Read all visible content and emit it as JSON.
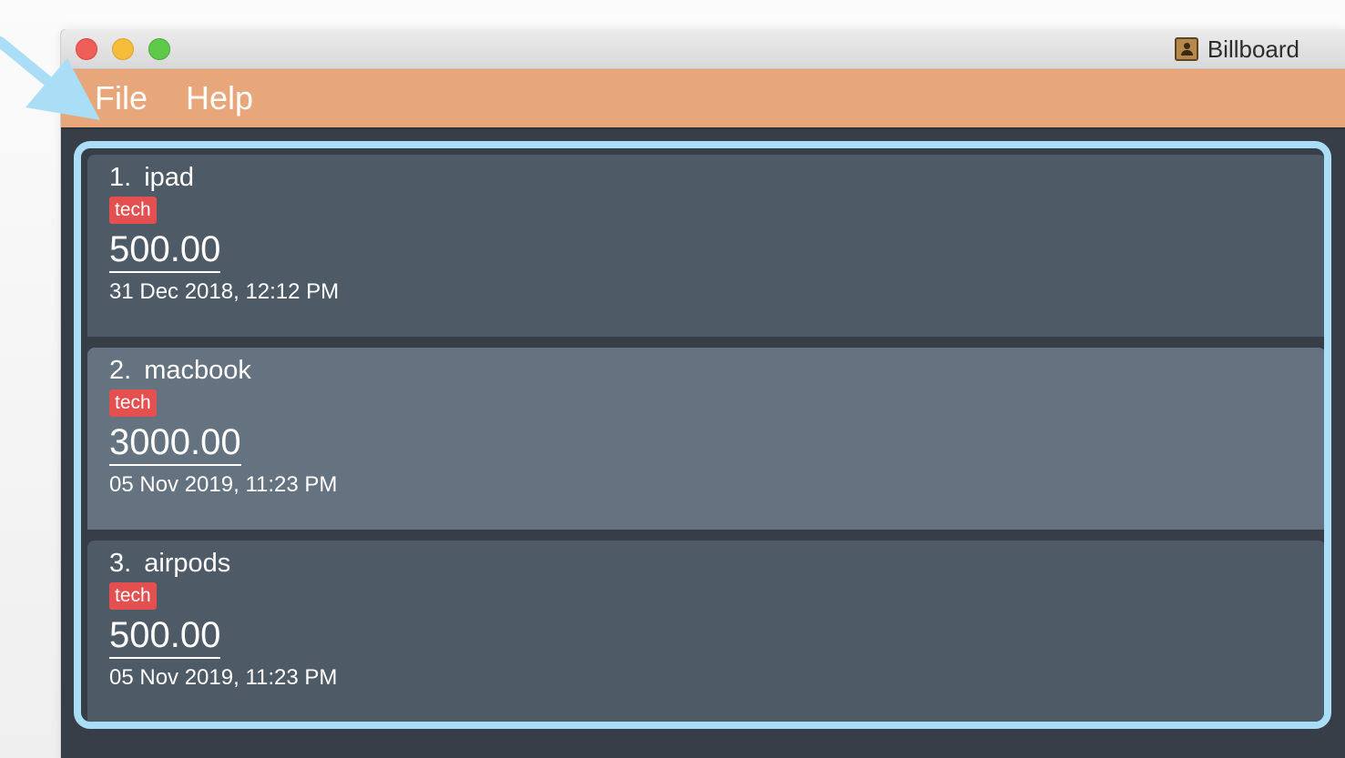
{
  "window": {
    "title": "Billboard"
  },
  "menu": {
    "items": [
      "File",
      "Help"
    ]
  },
  "expenses": [
    {
      "index": "1.",
      "name": "ipad",
      "tag": "tech",
      "amount": "500.00",
      "date": "31 Dec 2018, 12:12 PM",
      "selected": false
    },
    {
      "index": "2.",
      "name": "macbook",
      "tag": "tech",
      "amount": "3000.00",
      "date": "05 Nov 2019, 11:23 PM",
      "selected": true
    },
    {
      "index": "3.",
      "name": "airpods",
      "tag": "tech",
      "amount": "500.00",
      "date": "05 Nov 2019, 11:23 PM",
      "selected": false
    }
  ],
  "colors": {
    "menubar": "#e8a77b",
    "highlight": "#a9def6",
    "card": "#4f5a67",
    "card_selected": "#657381",
    "tag": "#e3504f",
    "background": "#383e48"
  }
}
